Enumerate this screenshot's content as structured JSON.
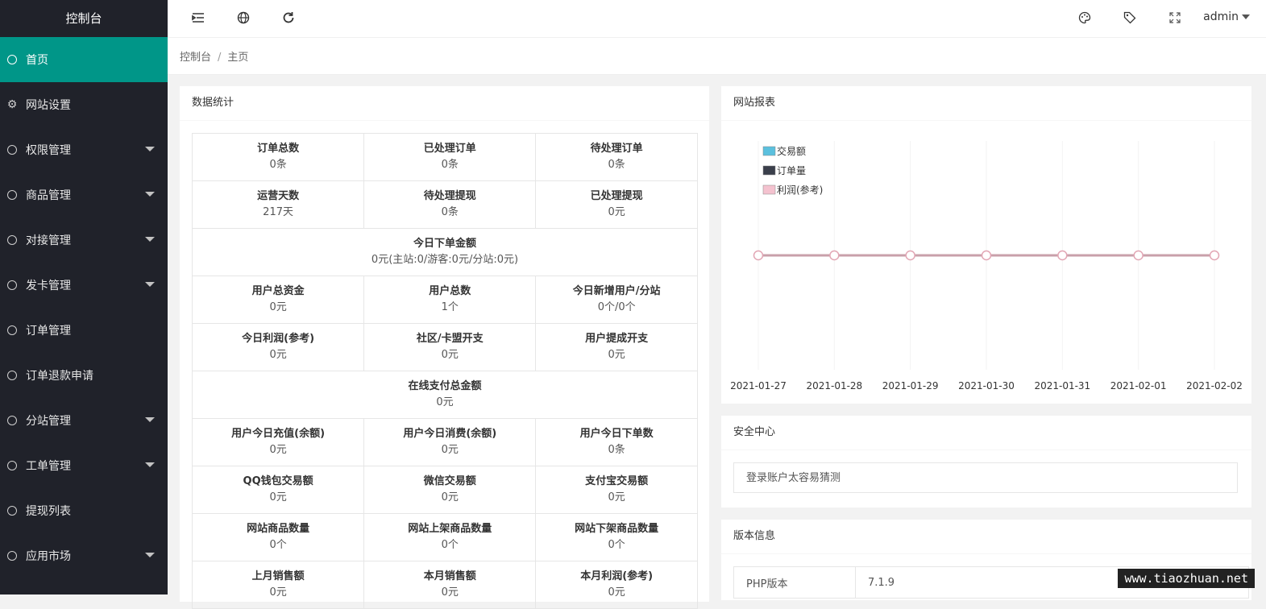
{
  "sidebar": {
    "title": "控制台",
    "items": [
      {
        "label": "首页"
      },
      {
        "label": "网站设置"
      },
      {
        "label": "权限管理"
      },
      {
        "label": "商品管理"
      },
      {
        "label": "对接管理"
      },
      {
        "label": "发卡管理"
      },
      {
        "label": "订单管理"
      },
      {
        "label": "订单退款申请"
      },
      {
        "label": "分站管理"
      },
      {
        "label": "工单管理"
      },
      {
        "label": "提现列表"
      },
      {
        "label": "应用市场"
      }
    ]
  },
  "header": {
    "user": "admin",
    "icons": [
      "menu-fold-icon",
      "globe-icon",
      "refresh-icon",
      "palette-icon",
      "tag-icon",
      "fullscreen-icon"
    ]
  },
  "breadcrumb": {
    "root": "控制台",
    "sep": "/",
    "current": "主页"
  },
  "stats": {
    "title": "数据统计",
    "rows": [
      [
        {
          "label": "订单总数",
          "value": "0条"
        },
        {
          "label": "已处理订单",
          "value": "0条"
        },
        {
          "label": "待处理订单",
          "value": "0条"
        }
      ],
      [
        {
          "label": "运营天数",
          "value": "217天"
        },
        {
          "label": "待处理提现",
          "value": "0条"
        },
        {
          "label": "已处理提现",
          "value": "0元"
        }
      ],
      [
        {
          "label": "今日下单金额",
          "value": "0元(主站:0/游客:0元/分站:0元)"
        }
      ],
      [
        {
          "label": "用户总资金",
          "value": "0元"
        },
        {
          "label": "用户总数",
          "value": "1个"
        },
        {
          "label": "今日新增用户/分站",
          "value": "0个/0个"
        }
      ],
      [
        {
          "label": "今日利润(参考)",
          "value": "0元"
        },
        {
          "label": "社区/卡盟开支",
          "value": "0元"
        },
        {
          "label": "用户提成开支",
          "value": "0元"
        }
      ],
      [
        {
          "label": "在线支付总金额",
          "value": "0元"
        }
      ],
      [
        {
          "label": "用户今日充值(余额)",
          "value": "0元"
        },
        {
          "label": "用户今日消费(余额)",
          "value": "0元"
        },
        {
          "label": "用户今日下单数",
          "value": "0条"
        }
      ],
      [
        {
          "label": "QQ钱包交易额",
          "value": "0元"
        },
        {
          "label": "微信交易额",
          "value": "0元"
        },
        {
          "label": "支付宝交易额",
          "value": "0元"
        }
      ],
      [
        {
          "label": "网站商品数量",
          "value": "0个"
        },
        {
          "label": "网站上架商品数量",
          "value": "0个"
        },
        {
          "label": "网站下架商品数量",
          "value": "0个"
        }
      ],
      [
        {
          "label": "上月销售额",
          "value": "0元"
        },
        {
          "label": "本月销售额",
          "value": "0元"
        },
        {
          "label": "本月利润(参考)",
          "value": "0元"
        }
      ]
    ]
  },
  "report": {
    "title": "网站报表"
  },
  "chart_data": {
    "type": "line",
    "x": [
      "2021-01-27",
      "2021-01-28",
      "2021-01-29",
      "2021-01-30",
      "2021-01-31",
      "2021-02-01",
      "2021-02-02"
    ],
    "series": [
      {
        "name": "交易额",
        "values": [
          0,
          0,
          0,
          0,
          0,
          0,
          0
        ],
        "color": "#5bc0de"
      },
      {
        "name": "订单量",
        "values": [
          0,
          0,
          0,
          0,
          0,
          0,
          0
        ],
        "color": "#3a3f4b"
      },
      {
        "name": "利润(参考)",
        "values": [
          0,
          0,
          0,
          0,
          0,
          0,
          0
        ],
        "color": "#f4c2cf"
      }
    ],
    "legend_position": "top-left",
    "grid": true
  },
  "security": {
    "title": "安全中心",
    "message": "登录账户太容易猜测"
  },
  "version": {
    "title": "版本信息",
    "rows": [
      {
        "key": "PHP版本",
        "value": "7.1.9"
      }
    ]
  },
  "watermark": "www.tiaozhuan.net"
}
